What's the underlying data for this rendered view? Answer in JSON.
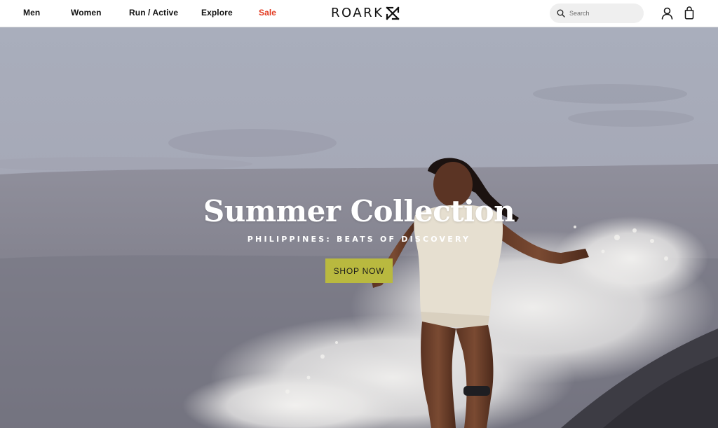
{
  "nav": {
    "items": [
      {
        "label": "Men"
      },
      {
        "label": "Women"
      },
      {
        "label": "Run / Active"
      },
      {
        "label": "Explore"
      },
      {
        "label": "Sale"
      }
    ]
  },
  "brand": {
    "name": "ROARK"
  },
  "search": {
    "placeholder": "Search",
    "value": ""
  },
  "icons": {
    "search": "search-icon",
    "account": "account-icon",
    "bag": "shopping-bag-icon",
    "logo_mark": "roark-x-mark-icon"
  },
  "hero": {
    "title": "Summer Collection",
    "subtitle": "PHILIPPINES: BEATS OF DISCOVERY",
    "cta_label": "SHOP NOW"
  },
  "colors": {
    "sale": "#e2391f",
    "cta_background": "#b9b93f",
    "text": "#111111"
  }
}
